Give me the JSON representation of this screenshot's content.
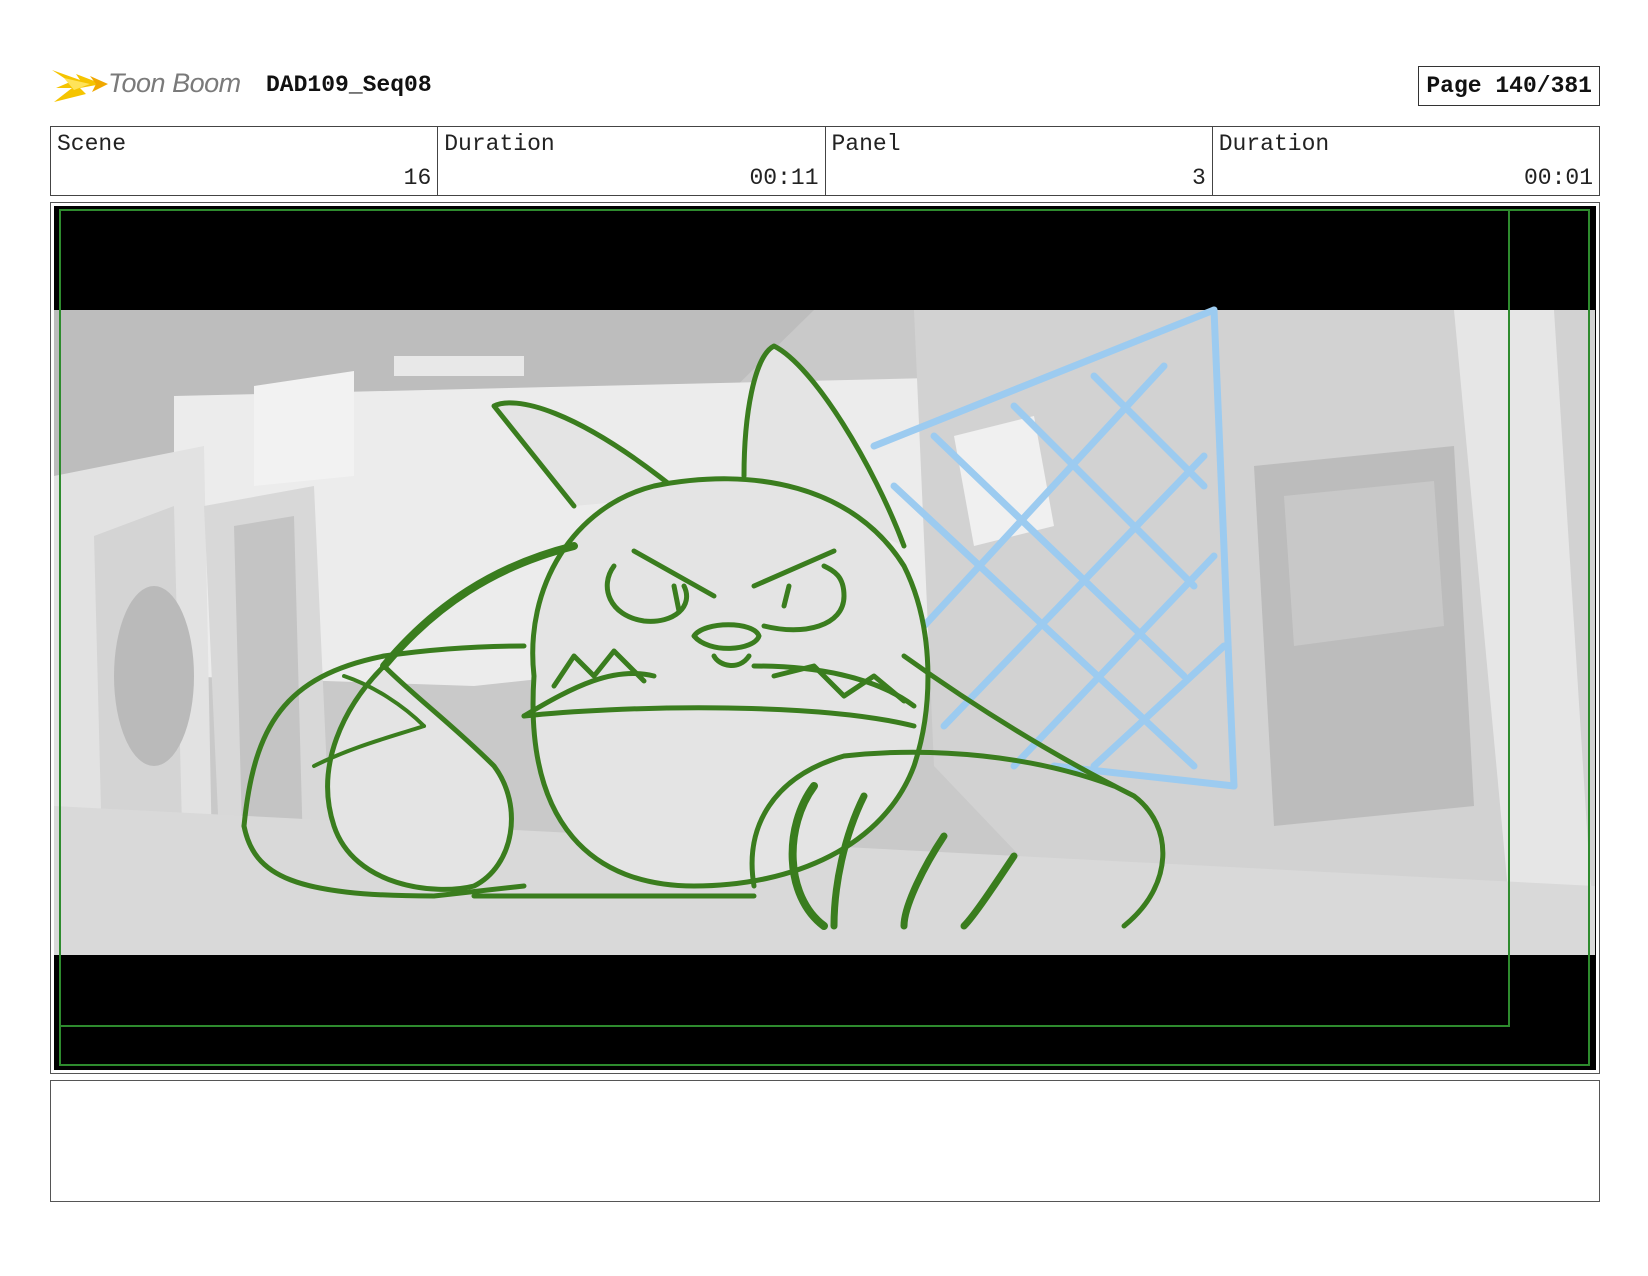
{
  "header": {
    "logo_text": "Toon Boom",
    "title": "DAD109_Seq08",
    "page_label": "Page 140/381"
  },
  "info": {
    "scene_label": "Scene",
    "scene_value": "16",
    "scene_duration_label": "Duration",
    "scene_duration_value": "00:11",
    "panel_label": "Panel",
    "panel_value": "3",
    "panel_duration_label": "Duration",
    "panel_duration_value": "00:01"
  },
  "notes": {
    "text": ""
  },
  "colors": {
    "sketch_line": "#3a7d1e",
    "net_line": "#9ccbf0",
    "safe_frame": "#2e8b2e",
    "logo_flash": "#f5c400"
  }
}
